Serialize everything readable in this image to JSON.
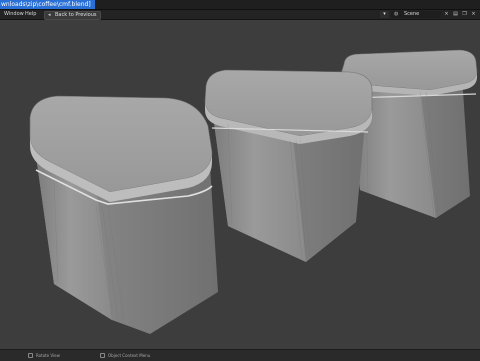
{
  "window": {
    "title_path": "wnloads\\zip\\coffee\\cmf.blend]"
  },
  "menu": {
    "items": [
      "Window",
      "Help"
    ],
    "back_button": "Back to Previous",
    "back_icon": "arrow-left-icon"
  },
  "header_right": {
    "scene_icon": "scene-icon",
    "scene_name": "Scene",
    "icons": [
      "close-icon",
      "view-layer-icon",
      "copy-icon",
      "close-icon"
    ]
  },
  "statusbar": {
    "rotate_view": "Rotate View",
    "context_menu": "Object Context Menu"
  },
  "colors": {
    "title_highlight": "#2a6fd6",
    "viewport_bg": "#3d3d3d"
  }
}
